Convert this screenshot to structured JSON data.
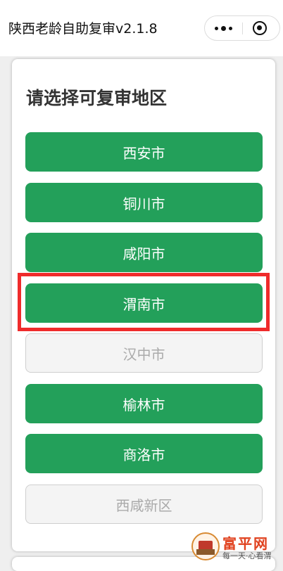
{
  "nav": {
    "title": "陕西老龄自助复审v2.1.8"
  },
  "card": {
    "heading": "请选择可复审地区"
  },
  "regions": [
    {
      "label": "西安市",
      "enabled": true
    },
    {
      "label": "铜川市",
      "enabled": true
    },
    {
      "label": "咸阳市",
      "enabled": true
    },
    {
      "label": "渭南市",
      "enabled": true
    },
    {
      "label": "汉中市",
      "enabled": false
    },
    {
      "label": "榆林市",
      "enabled": true
    },
    {
      "label": "商洛市",
      "enabled": true
    },
    {
      "label": "西咸新区",
      "enabled": false
    }
  ],
  "watermark": {
    "name": "富平网",
    "slogan": "每一天·心看渭"
  },
  "colors": {
    "primary": "#23a05a",
    "disabled_bg": "#f4f4f4",
    "highlight": "#ef2b2b"
  },
  "icons": {
    "more": "more-dots-icon",
    "close": "close-miniprogram-icon"
  }
}
